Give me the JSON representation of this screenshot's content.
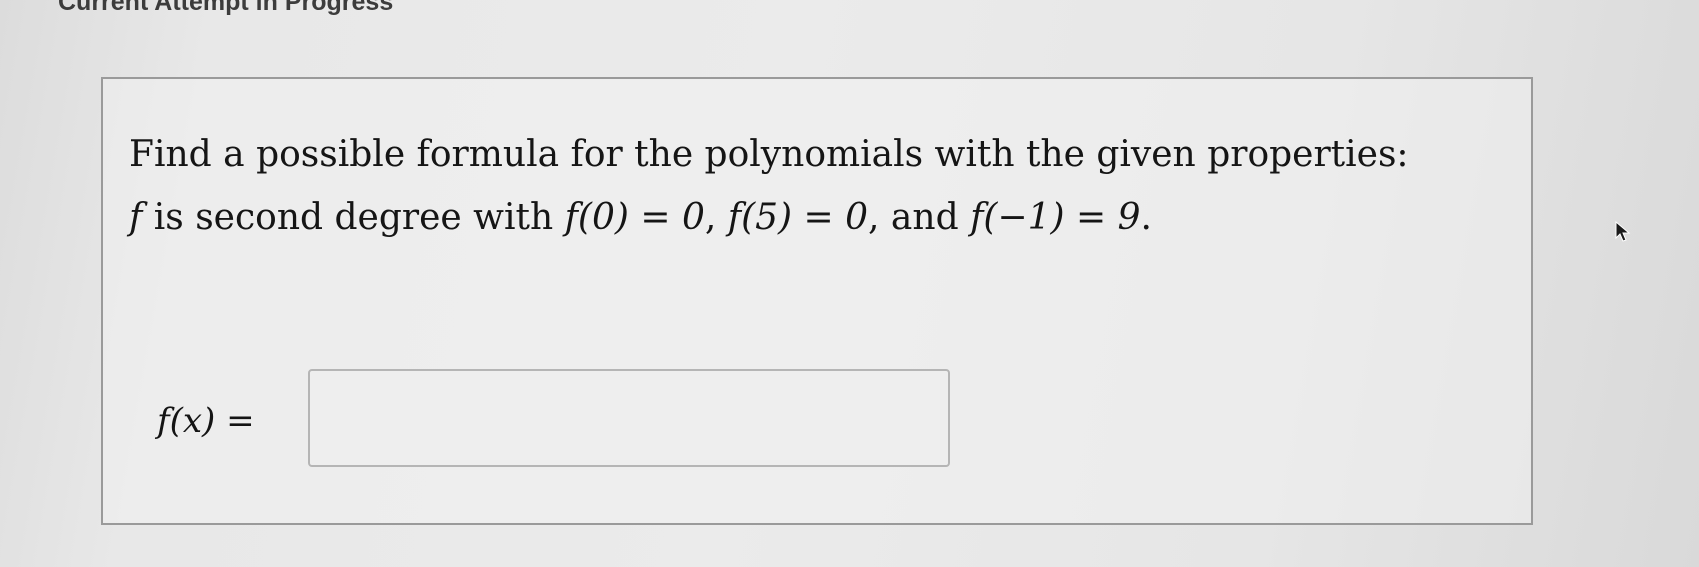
{
  "page": {
    "heading": "Current Attempt in Progress"
  },
  "question": {
    "line1": "Find a possible formula for the polynomials with the given properties:",
    "line2_prefix": "f",
    "line2_text": " is second degree with ",
    "cond1": "f(0) = 0",
    "sep1": ", ",
    "cond2": "f(5) = 0",
    "sep2": ", and ",
    "cond3": "f(−1) = 9",
    "end": "."
  },
  "answer": {
    "label": "f(x) =",
    "value": "",
    "placeholder": ""
  },
  "icons": {
    "cursor": "mouse-pointer-icon"
  },
  "colors": {
    "background": "#e8e8e8",
    "box_border": "#9a9a9a",
    "input_border": "#b5b5b5"
  }
}
